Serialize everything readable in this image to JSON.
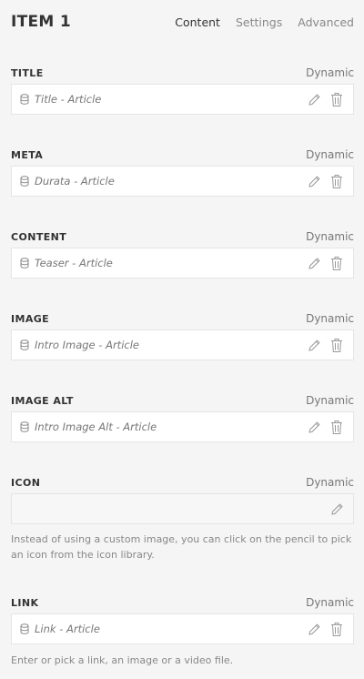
{
  "header": {
    "title": "ITEM 1",
    "tabs": [
      {
        "label": "Content",
        "active": true
      },
      {
        "label": "Settings",
        "active": false
      },
      {
        "label": "Advanced",
        "active": false
      }
    ]
  },
  "fields": {
    "title": {
      "label": "TITLE",
      "dynamic": "Dynamic",
      "value": "Title - Article"
    },
    "meta": {
      "label": "META",
      "dynamic": "Dynamic",
      "value": "Durata - Article"
    },
    "content": {
      "label": "CONTENT",
      "dynamic": "Dynamic",
      "value": "Teaser - Article"
    },
    "image": {
      "label": "IMAGE",
      "dynamic": "Dynamic",
      "value": "Intro Image - Article"
    },
    "image_alt": {
      "label": "IMAGE ALT",
      "dynamic": "Dynamic",
      "value": "Intro Image Alt - Article"
    },
    "icon": {
      "label": "ICON",
      "dynamic": "Dynamic",
      "value": "",
      "help": "Instead of using a custom image, you can click on the pencil to pick an icon from the icon library."
    },
    "link": {
      "label": "LINK",
      "dynamic": "Dynamic",
      "value": "Link - Article",
      "help": "Enter or pick a link, an image or a video file."
    }
  },
  "icons": {
    "source": "database-icon",
    "edit": "pencil-icon",
    "remove": "trash-icon"
  },
  "colors": {
    "background": "#f5f5f5",
    "field_bg": "#ffffff",
    "border": "#e5e5e5",
    "text": "#333333",
    "muted": "#888888"
  }
}
